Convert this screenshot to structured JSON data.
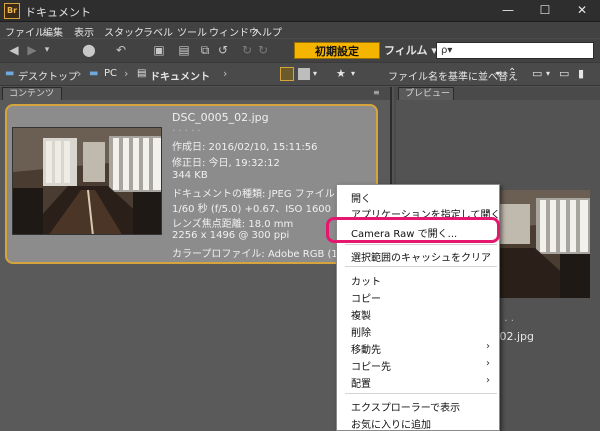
{
  "window": {
    "app_icon": "Br",
    "title": "ドキュメント",
    "minimize": "—",
    "maximize": "☐",
    "close": "✕"
  },
  "menubar": [
    "ファイル",
    "編集",
    "表示",
    "スタック",
    "ラベル",
    "ツール",
    "ウィンドウ",
    "ヘルプ"
  ],
  "toolbar": {
    "workspace_active": "初期設定",
    "workspace_film": "フィルム ▾",
    "search_placeholder": "ρ▾"
  },
  "pathbar": {
    "crumbs": [
      "デスクトップ",
      "PC",
      "ドキュメント"
    ],
    "sort_label": "ファイル名を基準に並べ替え"
  },
  "panels": {
    "content_tab": "コンテンツ",
    "preview_tab": "プレビュー"
  },
  "thumbnail": {
    "filename": "DSC_0005_02.jpg",
    "dots": "· · · · ·",
    "created": "作成日: 2016/02/10, 15:11:56",
    "modified": "修正日: 今日, 19:32:12",
    "size": "344 KB",
    "doc_type": "ドキュメントの種類: JPEG ファイル",
    "exposure": "1/60 秒 (f/5.0) +0.67、ISO 1600",
    "focal_length": "レンズ焦点距離: 18.0 mm",
    "dimensions": "2256 x 1496 @ 300 ppi",
    "color_profile": "カラープロファイル: Adobe RGB (19"
  },
  "preview": {
    "caption": "_02.jpg",
    "dots": "· · ·"
  },
  "context_menu": {
    "items": [
      {
        "label": "開く",
        "submenu": false
      },
      {
        "label": "アプリケーションを指定して開く",
        "submenu": true
      },
      {
        "label": "Camera Raw で開く...",
        "submenu": false,
        "highlighted": true
      },
      {
        "label": "選択範囲のキャッシュをクリア",
        "submenu": false
      },
      {
        "label": "カット",
        "submenu": false
      },
      {
        "label": "コピー",
        "submenu": false
      },
      {
        "label": "複製",
        "submenu": false
      },
      {
        "label": "削除",
        "submenu": false
      },
      {
        "label": "移動先",
        "submenu": true
      },
      {
        "label": "コピー先",
        "submenu": true
      },
      {
        "label": "配置",
        "submenu": true
      },
      {
        "label": "エクスプローラーで表示",
        "submenu": false
      },
      {
        "label": "お気に入りに追加",
        "submenu": false
      }
    ]
  },
  "colors": {
    "accent": "#f5b400",
    "selection_border": "#d6a43a",
    "highlight_ring": "#e5176e"
  }
}
